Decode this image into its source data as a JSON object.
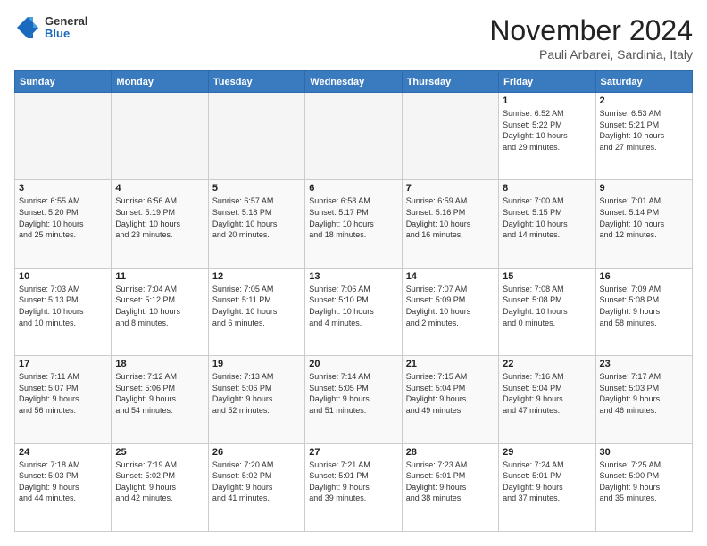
{
  "logo": {
    "general": "General",
    "blue": "Blue"
  },
  "header": {
    "month": "November 2024",
    "location": "Pauli Arbarei, Sardinia, Italy"
  },
  "weekdays": [
    "Sunday",
    "Monday",
    "Tuesday",
    "Wednesday",
    "Thursday",
    "Friday",
    "Saturday"
  ],
  "weeks": [
    [
      {
        "day": "",
        "info": ""
      },
      {
        "day": "",
        "info": ""
      },
      {
        "day": "",
        "info": ""
      },
      {
        "day": "",
        "info": ""
      },
      {
        "day": "",
        "info": ""
      },
      {
        "day": "1",
        "info": "Sunrise: 6:52 AM\nSunset: 5:22 PM\nDaylight: 10 hours\nand 29 minutes."
      },
      {
        "day": "2",
        "info": "Sunrise: 6:53 AM\nSunset: 5:21 PM\nDaylight: 10 hours\nand 27 minutes."
      }
    ],
    [
      {
        "day": "3",
        "info": "Sunrise: 6:55 AM\nSunset: 5:20 PM\nDaylight: 10 hours\nand 25 minutes."
      },
      {
        "day": "4",
        "info": "Sunrise: 6:56 AM\nSunset: 5:19 PM\nDaylight: 10 hours\nand 23 minutes."
      },
      {
        "day": "5",
        "info": "Sunrise: 6:57 AM\nSunset: 5:18 PM\nDaylight: 10 hours\nand 20 minutes."
      },
      {
        "day": "6",
        "info": "Sunrise: 6:58 AM\nSunset: 5:17 PM\nDaylight: 10 hours\nand 18 minutes."
      },
      {
        "day": "7",
        "info": "Sunrise: 6:59 AM\nSunset: 5:16 PM\nDaylight: 10 hours\nand 16 minutes."
      },
      {
        "day": "8",
        "info": "Sunrise: 7:00 AM\nSunset: 5:15 PM\nDaylight: 10 hours\nand 14 minutes."
      },
      {
        "day": "9",
        "info": "Sunrise: 7:01 AM\nSunset: 5:14 PM\nDaylight: 10 hours\nand 12 minutes."
      }
    ],
    [
      {
        "day": "10",
        "info": "Sunrise: 7:03 AM\nSunset: 5:13 PM\nDaylight: 10 hours\nand 10 minutes."
      },
      {
        "day": "11",
        "info": "Sunrise: 7:04 AM\nSunset: 5:12 PM\nDaylight: 10 hours\nand 8 minutes."
      },
      {
        "day": "12",
        "info": "Sunrise: 7:05 AM\nSunset: 5:11 PM\nDaylight: 10 hours\nand 6 minutes."
      },
      {
        "day": "13",
        "info": "Sunrise: 7:06 AM\nSunset: 5:10 PM\nDaylight: 10 hours\nand 4 minutes."
      },
      {
        "day": "14",
        "info": "Sunrise: 7:07 AM\nSunset: 5:09 PM\nDaylight: 10 hours\nand 2 minutes."
      },
      {
        "day": "15",
        "info": "Sunrise: 7:08 AM\nSunset: 5:08 PM\nDaylight: 10 hours\nand 0 minutes."
      },
      {
        "day": "16",
        "info": "Sunrise: 7:09 AM\nSunset: 5:08 PM\nDaylight: 9 hours\nand 58 minutes."
      }
    ],
    [
      {
        "day": "17",
        "info": "Sunrise: 7:11 AM\nSunset: 5:07 PM\nDaylight: 9 hours\nand 56 minutes."
      },
      {
        "day": "18",
        "info": "Sunrise: 7:12 AM\nSunset: 5:06 PM\nDaylight: 9 hours\nand 54 minutes."
      },
      {
        "day": "19",
        "info": "Sunrise: 7:13 AM\nSunset: 5:06 PM\nDaylight: 9 hours\nand 52 minutes."
      },
      {
        "day": "20",
        "info": "Sunrise: 7:14 AM\nSunset: 5:05 PM\nDaylight: 9 hours\nand 51 minutes."
      },
      {
        "day": "21",
        "info": "Sunrise: 7:15 AM\nSunset: 5:04 PM\nDaylight: 9 hours\nand 49 minutes."
      },
      {
        "day": "22",
        "info": "Sunrise: 7:16 AM\nSunset: 5:04 PM\nDaylight: 9 hours\nand 47 minutes."
      },
      {
        "day": "23",
        "info": "Sunrise: 7:17 AM\nSunset: 5:03 PM\nDaylight: 9 hours\nand 46 minutes."
      }
    ],
    [
      {
        "day": "24",
        "info": "Sunrise: 7:18 AM\nSunset: 5:03 PM\nDaylight: 9 hours\nand 44 minutes."
      },
      {
        "day": "25",
        "info": "Sunrise: 7:19 AM\nSunset: 5:02 PM\nDaylight: 9 hours\nand 42 minutes."
      },
      {
        "day": "26",
        "info": "Sunrise: 7:20 AM\nSunset: 5:02 PM\nDaylight: 9 hours\nand 41 minutes."
      },
      {
        "day": "27",
        "info": "Sunrise: 7:21 AM\nSunset: 5:01 PM\nDaylight: 9 hours\nand 39 minutes."
      },
      {
        "day": "28",
        "info": "Sunrise: 7:23 AM\nSunset: 5:01 PM\nDaylight: 9 hours\nand 38 minutes."
      },
      {
        "day": "29",
        "info": "Sunrise: 7:24 AM\nSunset: 5:01 PM\nDaylight: 9 hours\nand 37 minutes."
      },
      {
        "day": "30",
        "info": "Sunrise: 7:25 AM\nSunset: 5:00 PM\nDaylight: 9 hours\nand 35 minutes."
      }
    ]
  ]
}
